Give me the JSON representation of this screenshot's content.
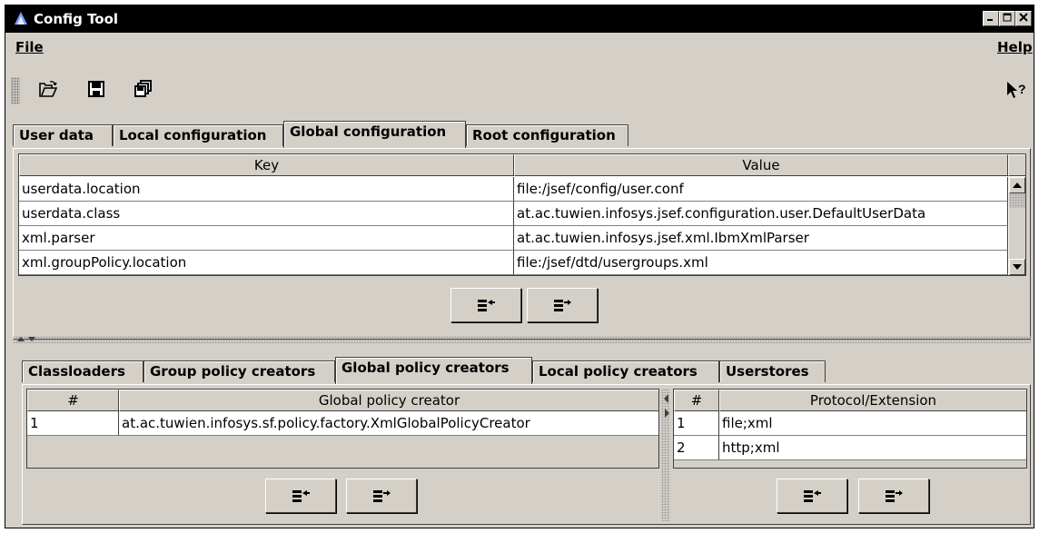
{
  "window": {
    "title": "Config Tool",
    "controls": [
      "minimize",
      "maximize",
      "close"
    ]
  },
  "menu": {
    "file": "File",
    "help": "Help"
  },
  "toolbar": {
    "buttons": [
      "open-folder-icon",
      "save-icon",
      "save-all-icon"
    ],
    "context_help": "context-help-icon"
  },
  "top_tabs": [
    {
      "label": "User data",
      "active": false
    },
    {
      "label": "Local configuration",
      "active": false
    },
    {
      "label": "Global configuration",
      "active": true
    },
    {
      "label": "Root configuration",
      "active": false
    }
  ],
  "config_table": {
    "headers": {
      "key": "Key",
      "value": "Value"
    },
    "rows": [
      {
        "key": "userdata.location",
        "value": "file:/jsef/config/user.conf"
      },
      {
        "key": "userdata.class",
        "value": "at.ac.tuwien.infosys.jsef.configuration.user.DefaultUserData"
      },
      {
        "key": "xml.parser",
        "value": "at.ac.tuwien.infosys.jsef.xml.IbmXmlParser"
      },
      {
        "key": "xml.groupPolicy.location",
        "value": "file:/jsef/dtd/usergroups.xml"
      }
    ]
  },
  "bottom_tabs": [
    {
      "label": "Classloaders",
      "active": false
    },
    {
      "label": "Group policy creators",
      "active": false
    },
    {
      "label": "Global policy creators",
      "active": true
    },
    {
      "label": "Local policy creators",
      "active": false
    },
    {
      "label": "Userstores",
      "active": false
    }
  ],
  "creator_table": {
    "headers": {
      "num": "#",
      "name": "Global policy creator"
    },
    "rows": [
      {
        "num": "1",
        "name": "at.ac.tuwien.infosys.sf.policy.factory.XmlGlobalPolicyCreator"
      }
    ]
  },
  "protocol_table": {
    "headers": {
      "num": "#",
      "name": "Protocol/Extension"
    },
    "rows": [
      {
        "num": "1",
        "name": "file;xml"
      },
      {
        "num": "2",
        "name": "http;xml"
      }
    ]
  },
  "icons": {
    "add_row": "insert-row-icon",
    "remove_row": "remove-row-icon"
  },
  "colors": {
    "face": "#d4d0c8",
    "titlebar": "#000000",
    "shadow": "#404040",
    "highlight": "#ffffff"
  }
}
